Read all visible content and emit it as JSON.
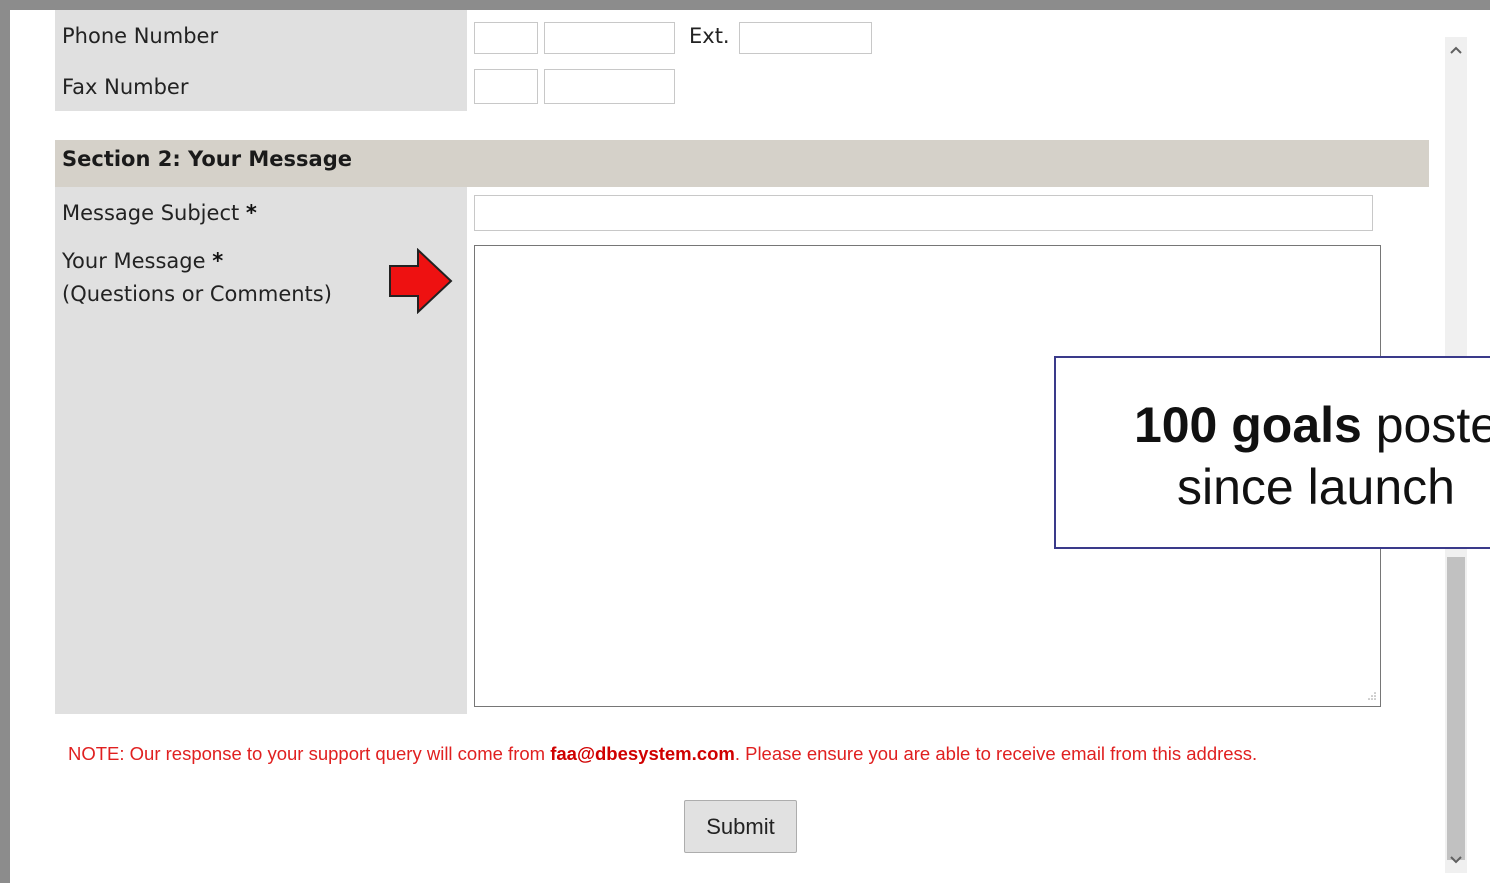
{
  "form": {
    "phone_label": "Phone Number",
    "ext_label": "Ext.",
    "fax_label": "Fax Number",
    "section2_title": "Section 2: Your Message",
    "subject_label": "Message Subject",
    "required_marker": "*",
    "message_label": "Your Message",
    "message_sublabel": "(Questions or Comments)",
    "subject_value": "",
    "message_value": "",
    "note_prefix": "NOTE: Our response to your support query will come from ",
    "note_email": "faa@dbesystem.com",
    "note_suffix": ". Please ensure you are able to receive email from this address.",
    "submit_label": "Submit"
  },
  "overlay": {
    "count_bold": "100 goals",
    "count_rest": " poste",
    "line2": "since launch"
  },
  "colors": {
    "arrow": "#ee1111",
    "note": "#e02020",
    "section_header_bg": "#d5d1c9",
    "label_bg": "#e0e0e0"
  },
  "icons": {
    "pointer_arrow": "red-right-arrow-icon",
    "scroll_up": "chevron-up-icon",
    "scroll_down": "chevron-down-icon"
  }
}
